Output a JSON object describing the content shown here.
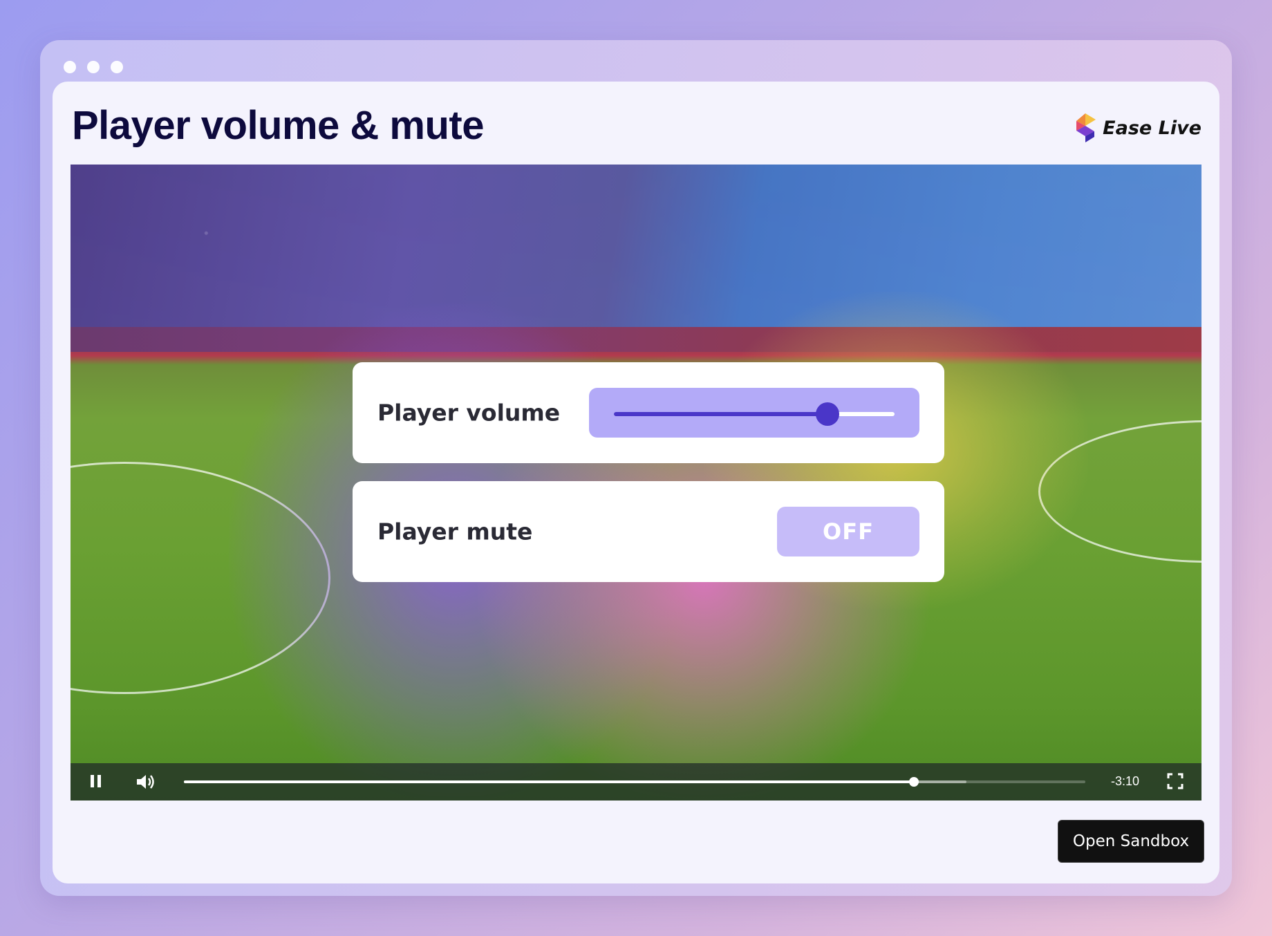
{
  "page": {
    "title": "Player volume & mute",
    "brand": {
      "name": "Ease Live",
      "icon": "ease-live-logo-icon"
    }
  },
  "overlay": {
    "volume": {
      "label": "Player volume",
      "value_fraction": 0.76
    },
    "mute": {
      "label": "Player mute",
      "state": "OFF"
    }
  },
  "player": {
    "time_remaining": "-3:10",
    "progress_fraction": 0.81,
    "buffered_fraction": 0.868,
    "icons": {
      "pause": "pause-icon",
      "volume": "volume-icon",
      "fullscreen": "fullscreen-icon"
    }
  },
  "actions": {
    "open_sandbox": "Open Sandbox"
  },
  "colors": {
    "accent": "#4a36c8",
    "slider_bg": "#b3aaf8",
    "mute_bg": "#c6bcf9",
    "title": "#0d0a3d"
  }
}
